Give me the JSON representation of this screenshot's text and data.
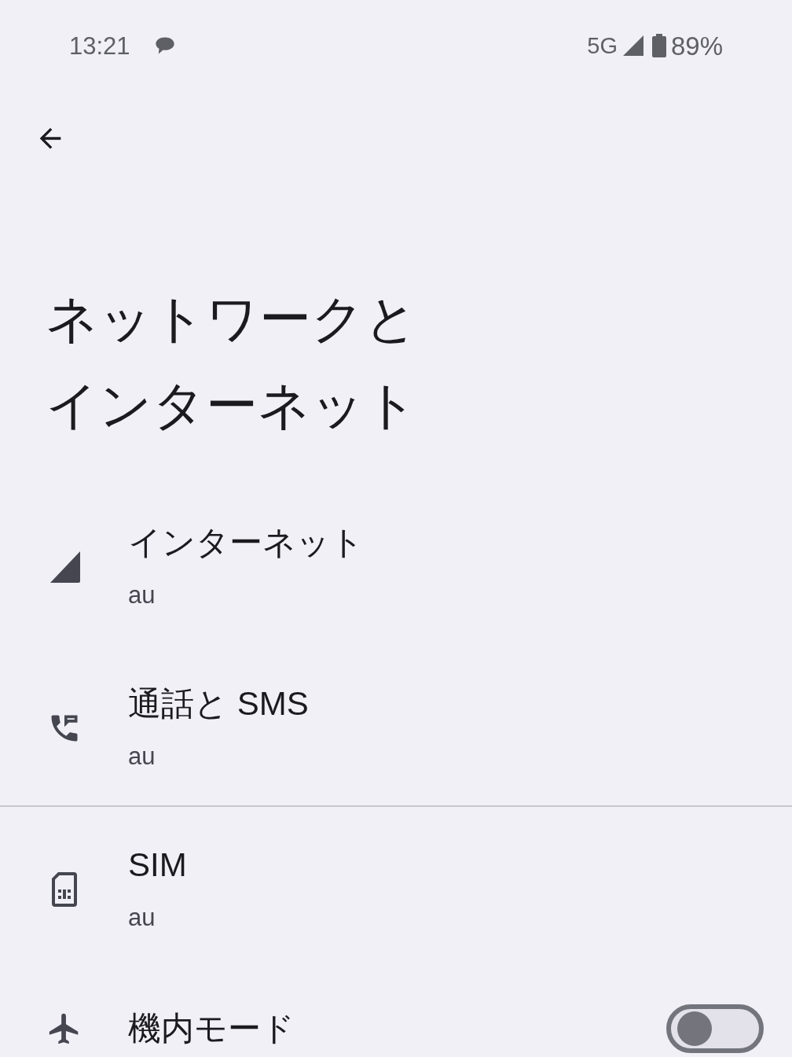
{
  "status_bar": {
    "time": "13:21",
    "network": "5G",
    "battery": "89%"
  },
  "title_lines": [
    "ネットワークと",
    "インターネット"
  ],
  "groups": [
    [
      {
        "kind": "link",
        "title": "インターネット",
        "subtitle": "au"
      },
      {
        "kind": "link",
        "title": "通話と SMS",
        "subtitle": "au"
      }
    ],
    [
      {
        "kind": "link",
        "title": "SIM",
        "subtitle": "au"
      },
      {
        "kind": "toggle",
        "title": "機内モード",
        "on": false
      }
    ]
  ]
}
